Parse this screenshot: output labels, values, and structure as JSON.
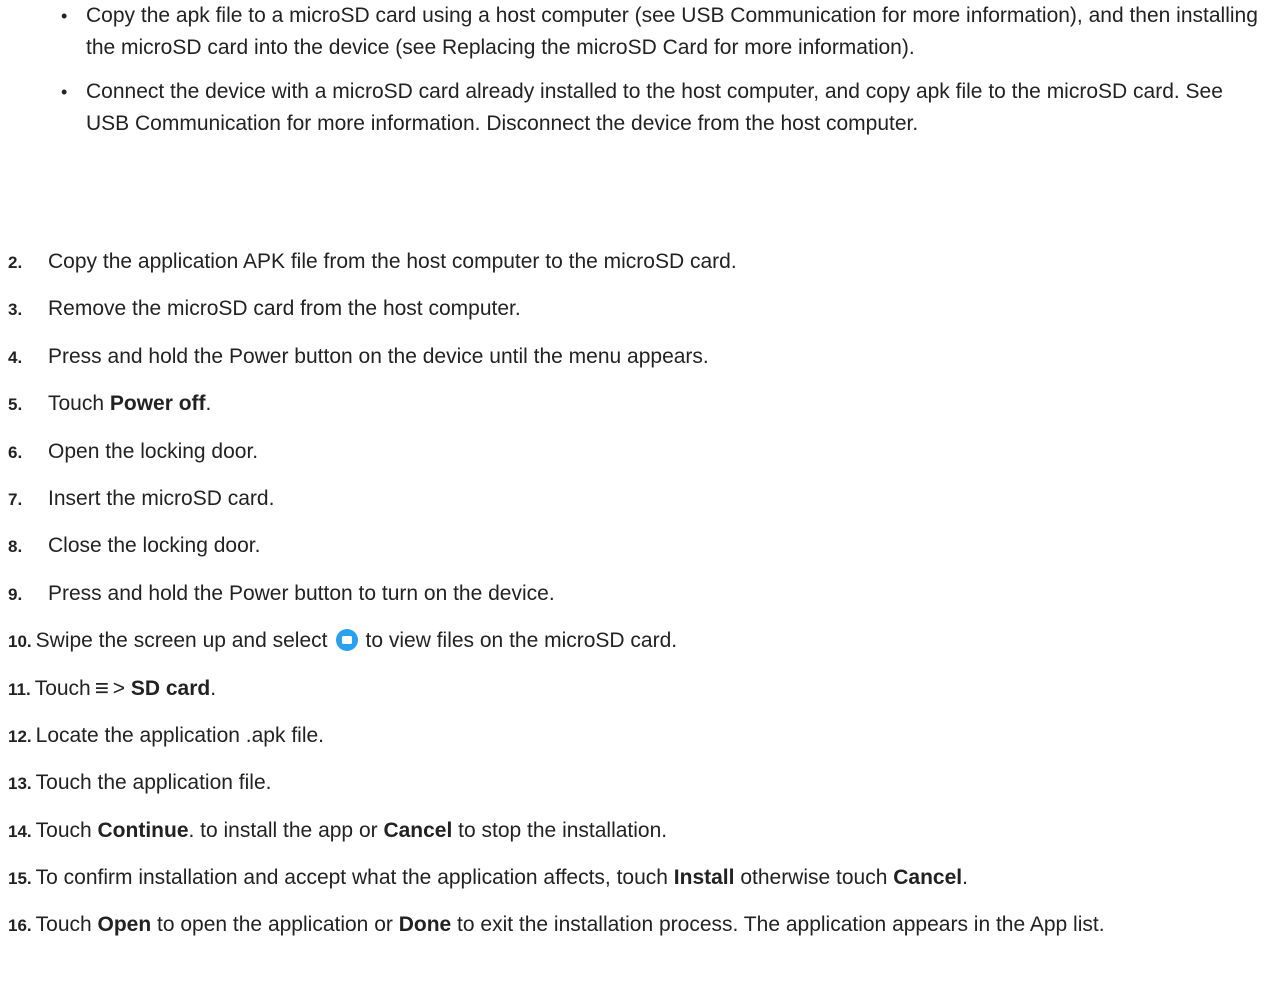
{
  "bullets": [
    {
      "bullet_char": "•",
      "text": "Copy the apk file to a microSD card using a host computer (see USB Communication for more information), and then installing the microSD card into the device (see Replacing the microSD Card for more information)."
    },
    {
      "bullet_char": "•",
      "text": "Connect the device with a microSD card already installed to the host computer, and copy apk file to the microSD card. See USB Communication for more information. Disconnect the device from the host computer."
    }
  ],
  "steps": {
    "s2": {
      "num": "2.",
      "text": "Copy the application APK file from the host computer to the microSD card."
    },
    "s3": {
      "num": "3.",
      "text": "Remove the microSD card from the host computer."
    },
    "s4": {
      "num": "4.",
      "text": "Press and hold the Power button on the device until the menu appears."
    },
    "s5": {
      "num": "5.",
      "pre": "Touch ",
      "bold": "Power off",
      "post": "."
    },
    "s6": {
      "num": "6.",
      "text": "Open the locking door."
    },
    "s7": {
      "num": "7.",
      "text": "Insert the microSD card."
    },
    "s8": {
      "num": "8.",
      "text": "Close the locking door."
    },
    "s9": {
      "num": "9.",
      "text": "Press and hold the Power button to turn on the device."
    },
    "s10": {
      "num": "10.",
      "pre": "Swipe the screen up and select",
      "post": "to view files on the microSD card.",
      "icon": "files-folder-icon"
    },
    "s11": {
      "num": "11.",
      "pre": "Touch",
      "menu_glyph": "≡",
      "mid": "> ",
      "bold": "SD card",
      "post": ".",
      "icon": "menu-icon"
    },
    "s12": {
      "num": "12.",
      "text": "Locate the application .apk file."
    },
    "s13": {
      "num": "13.",
      "text": "Touch the application file."
    },
    "s14": {
      "num": "14.",
      "pre": "Touch ",
      "bold1": "Continue",
      "mid": ". to install the app or ",
      "bold2": "Cancel",
      "post": " to stop the installation."
    },
    "s15": {
      "num": "15.",
      "pre": "To confirm installation and accept what the application affects, touch ",
      "bold1": "Install",
      "mid": " otherwise touch ",
      "bold2": "Cancel",
      "post": "."
    },
    "s16": {
      "num": "16.",
      "pre": "Touch ",
      "bold1": "Open",
      "mid": " to open the application or ",
      "bold2": "Done",
      "post": " to exit the installation process. The application appears in the App list."
    }
  },
  "colors": {
    "text": "#222222",
    "folder_icon": "#2aa0ee"
  }
}
